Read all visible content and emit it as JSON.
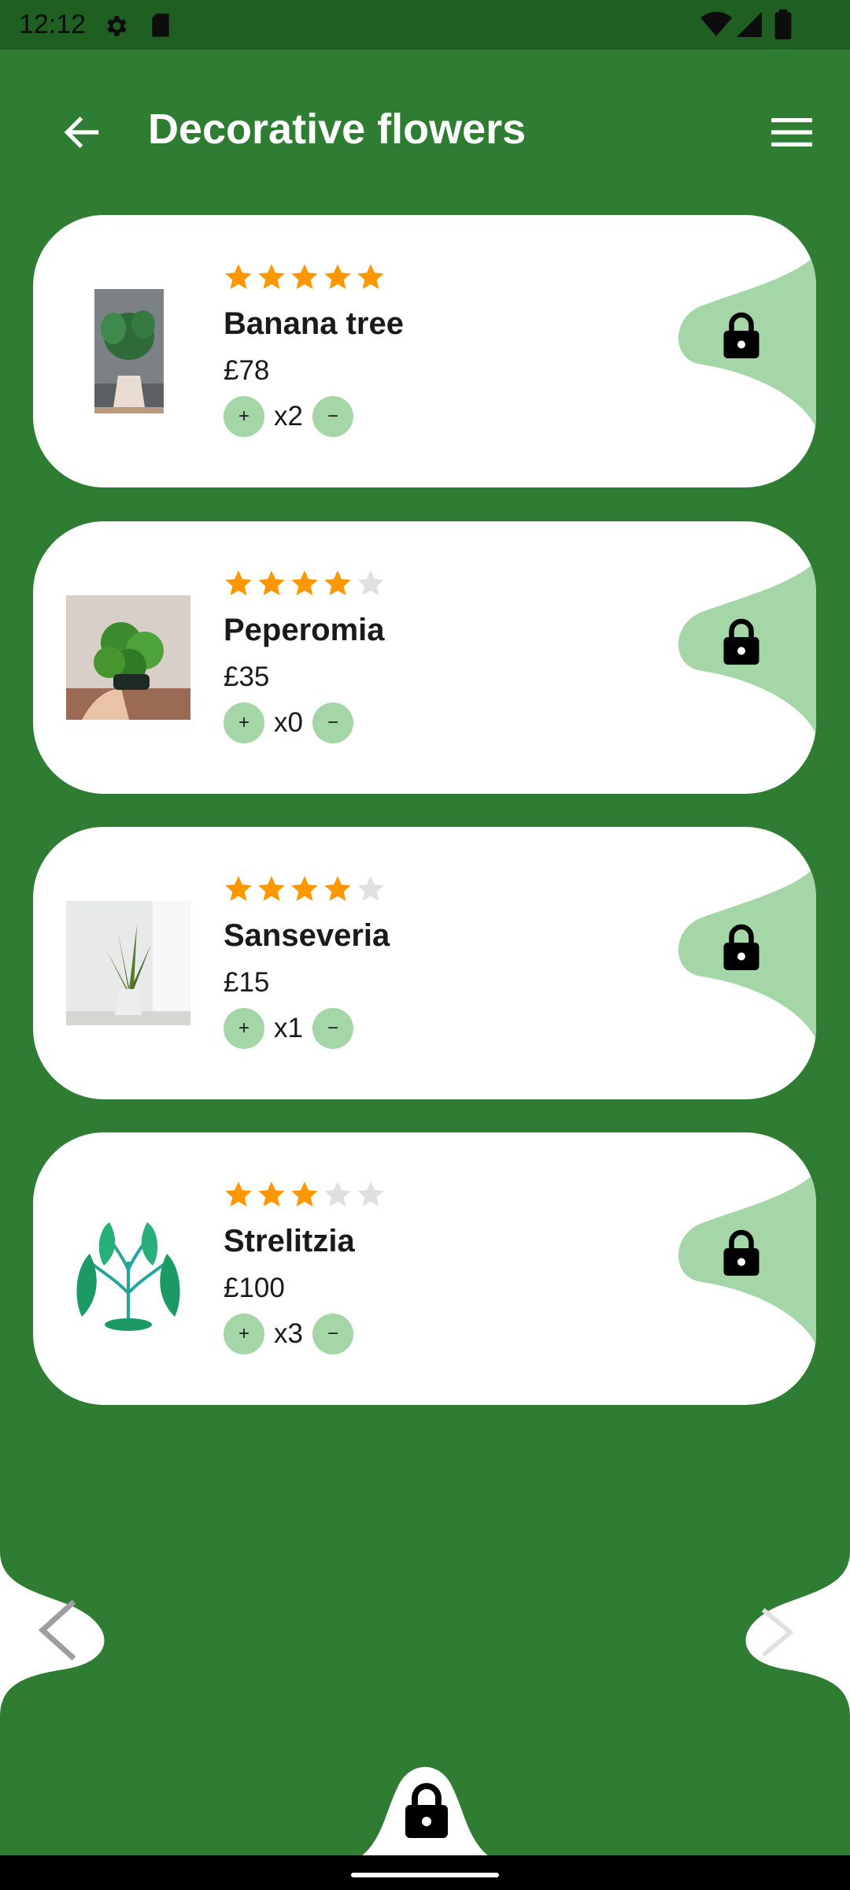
{
  "status_bar": {
    "time": "12:12",
    "icons": [
      "settings-icon",
      "sd-card-icon",
      "wifi-icon",
      "signal-icon",
      "battery-icon"
    ]
  },
  "header": {
    "title": "Decorative flowers",
    "back_icon": "arrow-left-icon",
    "menu_icon": "menu-icon"
  },
  "colors": {
    "background": "#2e7d32",
    "accent_light": "#a5d6a7",
    "star_on": "#ff9800",
    "star_off": "#e0e0e0"
  },
  "products": [
    {
      "name": "Banana tree",
      "price": "£78",
      "rating": 5,
      "quantity": "x2",
      "plus": "+",
      "minus": "−",
      "image": "monstera-plant-image"
    },
    {
      "name": "Peperomia",
      "price": "£35",
      "rating": 4,
      "quantity": "x0",
      "plus": "+",
      "minus": "−",
      "image": "peperomia-plant-image"
    },
    {
      "name": "Sanseveria",
      "price": "£15",
      "rating": 4,
      "quantity": "x1",
      "plus": "+",
      "minus": "−",
      "image": "snake-plant-image"
    },
    {
      "name": "Strelitzia",
      "price": "£100",
      "rating": 3,
      "quantity": "x3",
      "plus": "+",
      "minus": "−",
      "image": "strelitzia-illustration"
    }
  ],
  "pagination": {
    "prev_icon": "chevron-left-icon",
    "next_icon": "chevron-right-icon"
  },
  "bottom": {
    "lock_icon": "lock-icon"
  }
}
